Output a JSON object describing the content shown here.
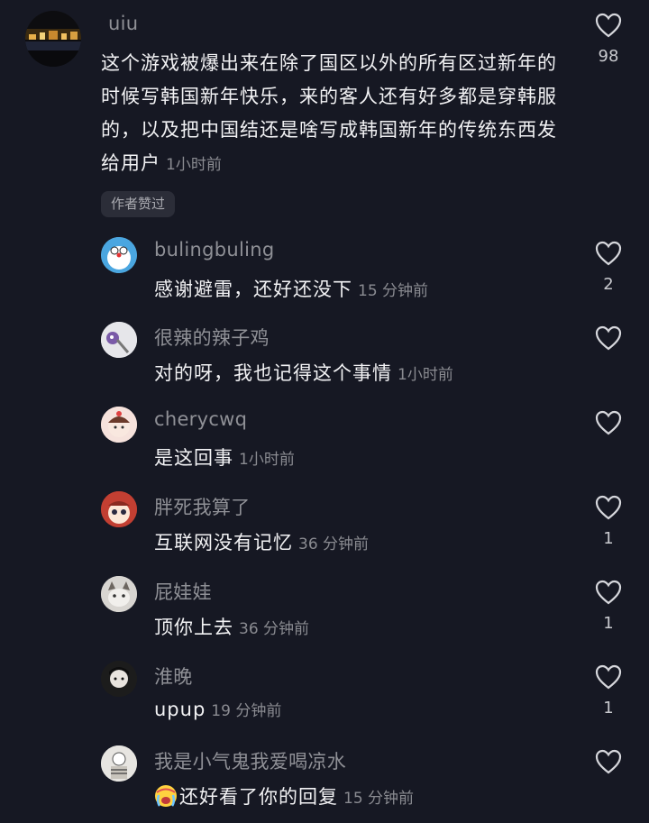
{
  "main_comment": {
    "username": "uiu",
    "text": "这个游戏被爆出来在除了国区以外的所有区过新年的时候写韩国新年快乐，来的客人还有好多都是穿韩服的，以及把中国结还是啥写成韩国新年的传统东西发给用户",
    "time": "1小时前",
    "badge": "作者赞过",
    "likes": "98"
  },
  "replies": [
    {
      "username": "bulingbuling",
      "text": "感谢避雷，还好还没下",
      "time": "15 分钟前",
      "likes": "2"
    },
    {
      "username": "很辣的辣子鸡",
      "text": "对的呀，我也记得这个事情",
      "time": "1小时前",
      "likes": ""
    },
    {
      "username": "cherycwq",
      "text": "是这回事",
      "time": "1小时前",
      "likes": ""
    },
    {
      "username": "胖死我算了",
      "text": "互联网没有记忆",
      "time": "36 分钟前",
      "likes": "1"
    },
    {
      "username": "屁娃娃",
      "text": "顶你上去",
      "time": "36 分钟前",
      "likes": "1"
    },
    {
      "username": "淮晚",
      "text": "upup",
      "time": "19 分钟前",
      "likes": "1"
    },
    {
      "username": "我是小气鬼我爱喝凉水",
      "text": "还好看了你的回复",
      "time": "15 分钟前",
      "likes": ""
    }
  ],
  "icons": {
    "like": "heart-outline-icon",
    "emoji": "crying-emoji-icon"
  },
  "colors": {
    "background": "#161823",
    "secondary_text": "#8f9096",
    "primary_text": "#f2f2f4"
  }
}
